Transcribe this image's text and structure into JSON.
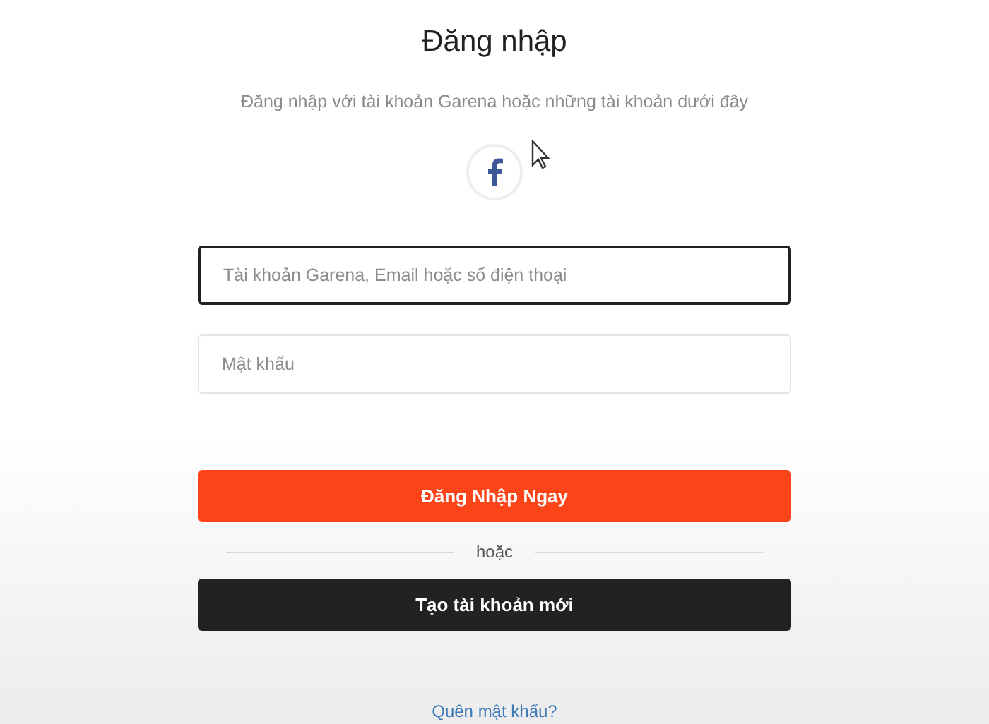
{
  "title": "Đăng nhập",
  "subtitle": "Đăng nhập với tài khoản Garena hoặc những tài khoản dưới đây",
  "social_buttons": [
    {
      "kind": "facebook"
    }
  ],
  "fields": [
    {
      "placeholder": "Tài khoản Garena, Email hoặc số điện thoại",
      "focused": true
    },
    {
      "placeholder": "Mật khẩu",
      "focused": false
    }
  ],
  "login_button": "Đăng Nhập Ngay",
  "divider": "hoặc",
  "create_button": "Tạo tài khoản mới",
  "forgot_link": "Quên mật khẩu?"
}
